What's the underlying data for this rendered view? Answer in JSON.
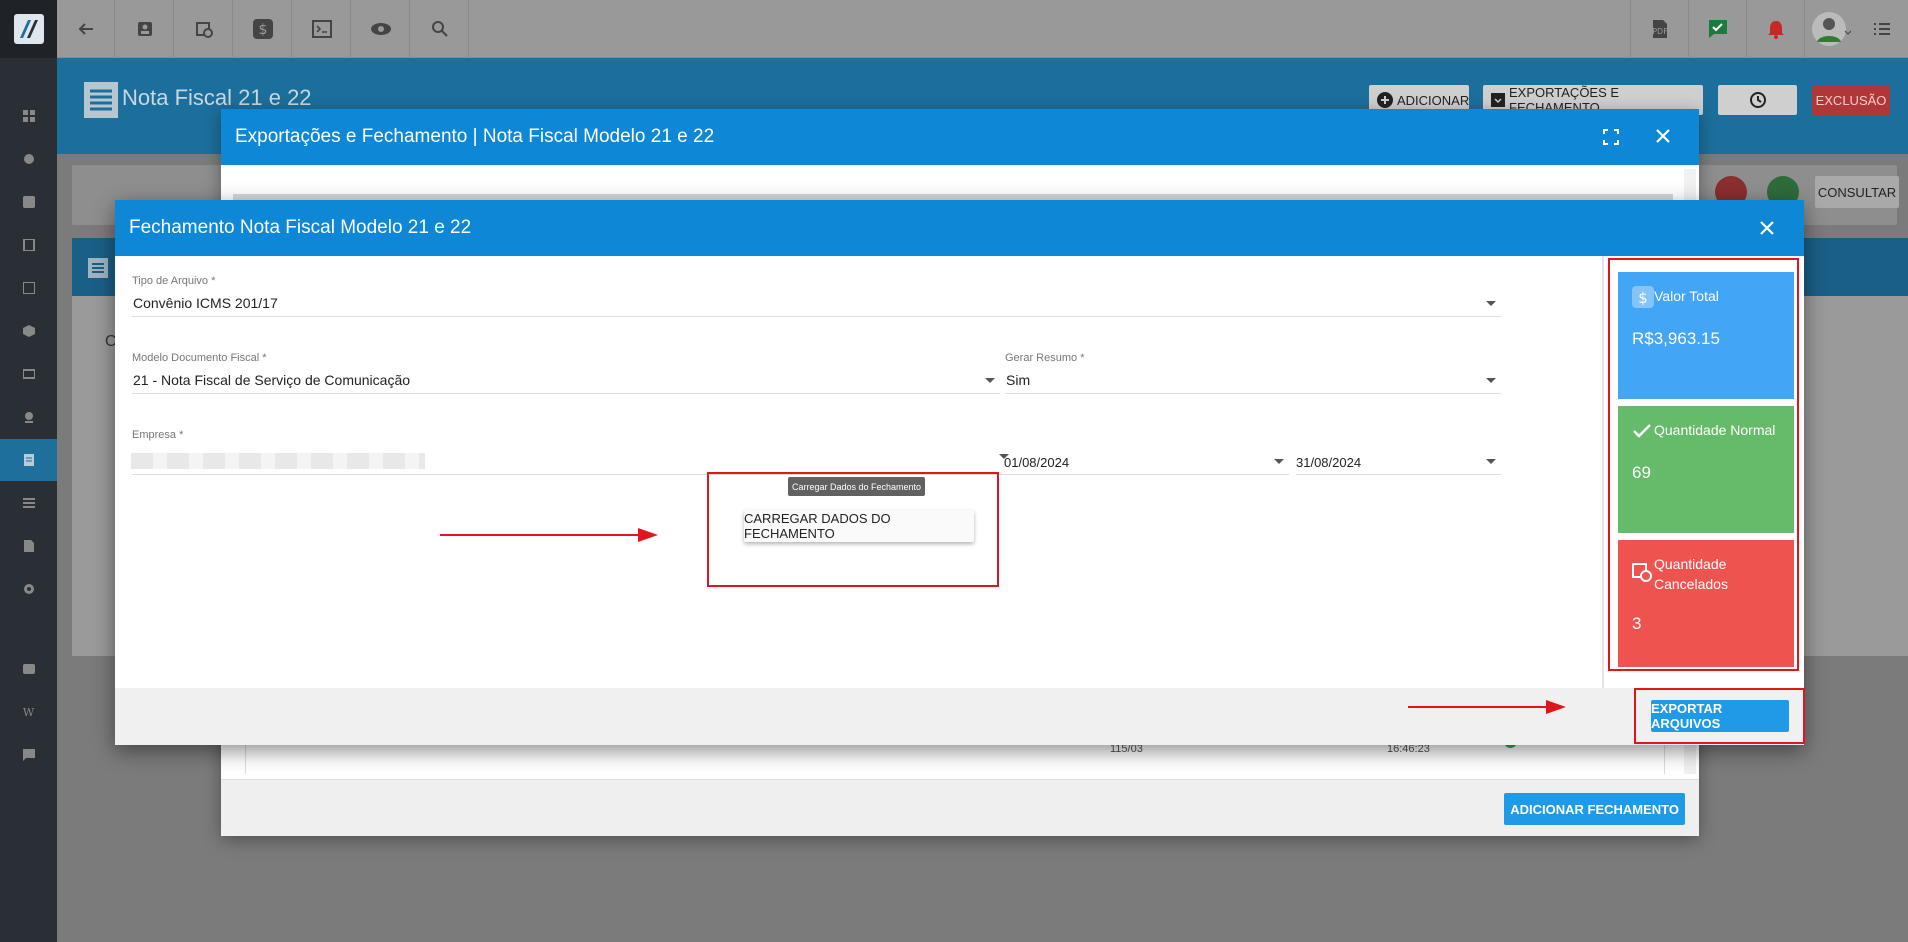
{
  "topbar": {
    "icons_left": [
      "back-arrow-icon",
      "contact-card-icon",
      "calendar-clock-icon",
      "dollar-icon",
      "terminal-icon",
      "eye-icon",
      "search-icon"
    ],
    "icons_right": [
      "pdf-icon",
      "check-message-icon",
      "alarm-bell-icon",
      "avatar",
      "menu-list-icon"
    ]
  },
  "sidebar": {
    "icons": [
      "dashboard-icon",
      "chart-pie-icon",
      "contact-icon",
      "book-icon",
      "calendar-icon",
      "cube-icon",
      "money-icon",
      "location-icon",
      "document-icon",
      "list-icon",
      "file-icon",
      "gear-icon",
      "video-icon",
      "wordpress-icon",
      "chat-icon"
    ],
    "active_index": 8
  },
  "page": {
    "title": "Nota Fiscal 21 e 22",
    "add_label": "ADICIONAR",
    "export_label": "EXPORTAÇÕES E FECHAMENTO",
    "exclusion_label": "EXCLUSÃO",
    "consultar_label": "CONSULTAR",
    "bg_letter": "C"
  },
  "outer_modal": {
    "title": "Exportações e Fechamento | Nota Fiscal Modelo 21 e 22",
    "add_fechamento_label": "ADICIONAR FECHAMENTO",
    "bg_row_texts": [
      "115/03",
      "16:46:23"
    ]
  },
  "inner_modal": {
    "title": "Fechamento Nota Fiscal Modelo 21 e 22",
    "tipo_arquivo": {
      "label": "Tipo de Arquivo",
      "value": "Convênio ICMS 201/17"
    },
    "modelo_documento": {
      "label": "Modelo Documento Fiscal",
      "value": "21 - Nota Fiscal de Serviço de Comunicação"
    },
    "gerar_resumo": {
      "label": "Gerar Resumo",
      "value": "Sim"
    },
    "empresa": {
      "label": "Empresa",
      "value": ""
    },
    "data_inicio": "01/08/2024",
    "data_fim": "31/08/2024",
    "required_mark": "*",
    "tooltip": "Carregar Dados do Fechamento",
    "carregar_label": "CARREGAR DADOS DO FECHAMENTO",
    "export_label": "EXPORTAR ARQUIVOS",
    "cards": [
      {
        "title": "Valor Total",
        "value": "R$3,963.15",
        "color": "#42a5f5",
        "icon": "dollar-icon"
      },
      {
        "title": "Quantidade Normal",
        "value": "69",
        "color": "#66bb6a",
        "icon": "check-icon"
      },
      {
        "title": "Quantidade Cancelados",
        "value": "3",
        "color": "#ef5350",
        "icon": "calendar-clock-icon"
      }
    ]
  }
}
